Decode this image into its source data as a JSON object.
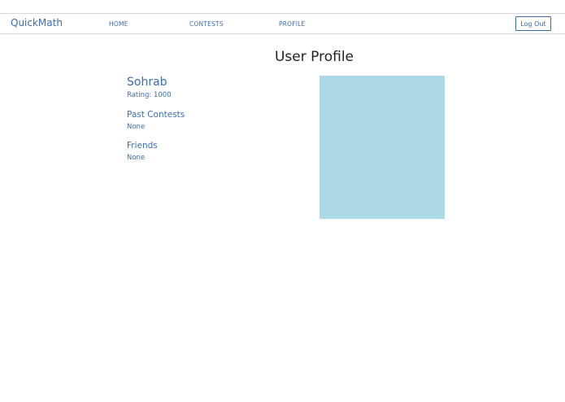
{
  "navbar": {
    "brand": "QuickMath",
    "links": [
      "HOME",
      "CONTESTS",
      "PROFILE"
    ],
    "logout_label": "Log Out"
  },
  "page": {
    "title": "User Profile"
  },
  "profile": {
    "name": "Sohrab",
    "rating_label": "Rating:",
    "rating_value": "1000",
    "past_contests_heading": "Past Contests",
    "past_contests_value": "None",
    "friends_heading": "Friends",
    "friends_value": "None"
  },
  "colors": {
    "accent": "#3a6db0",
    "picture_placeholder": "#add8e6"
  }
}
